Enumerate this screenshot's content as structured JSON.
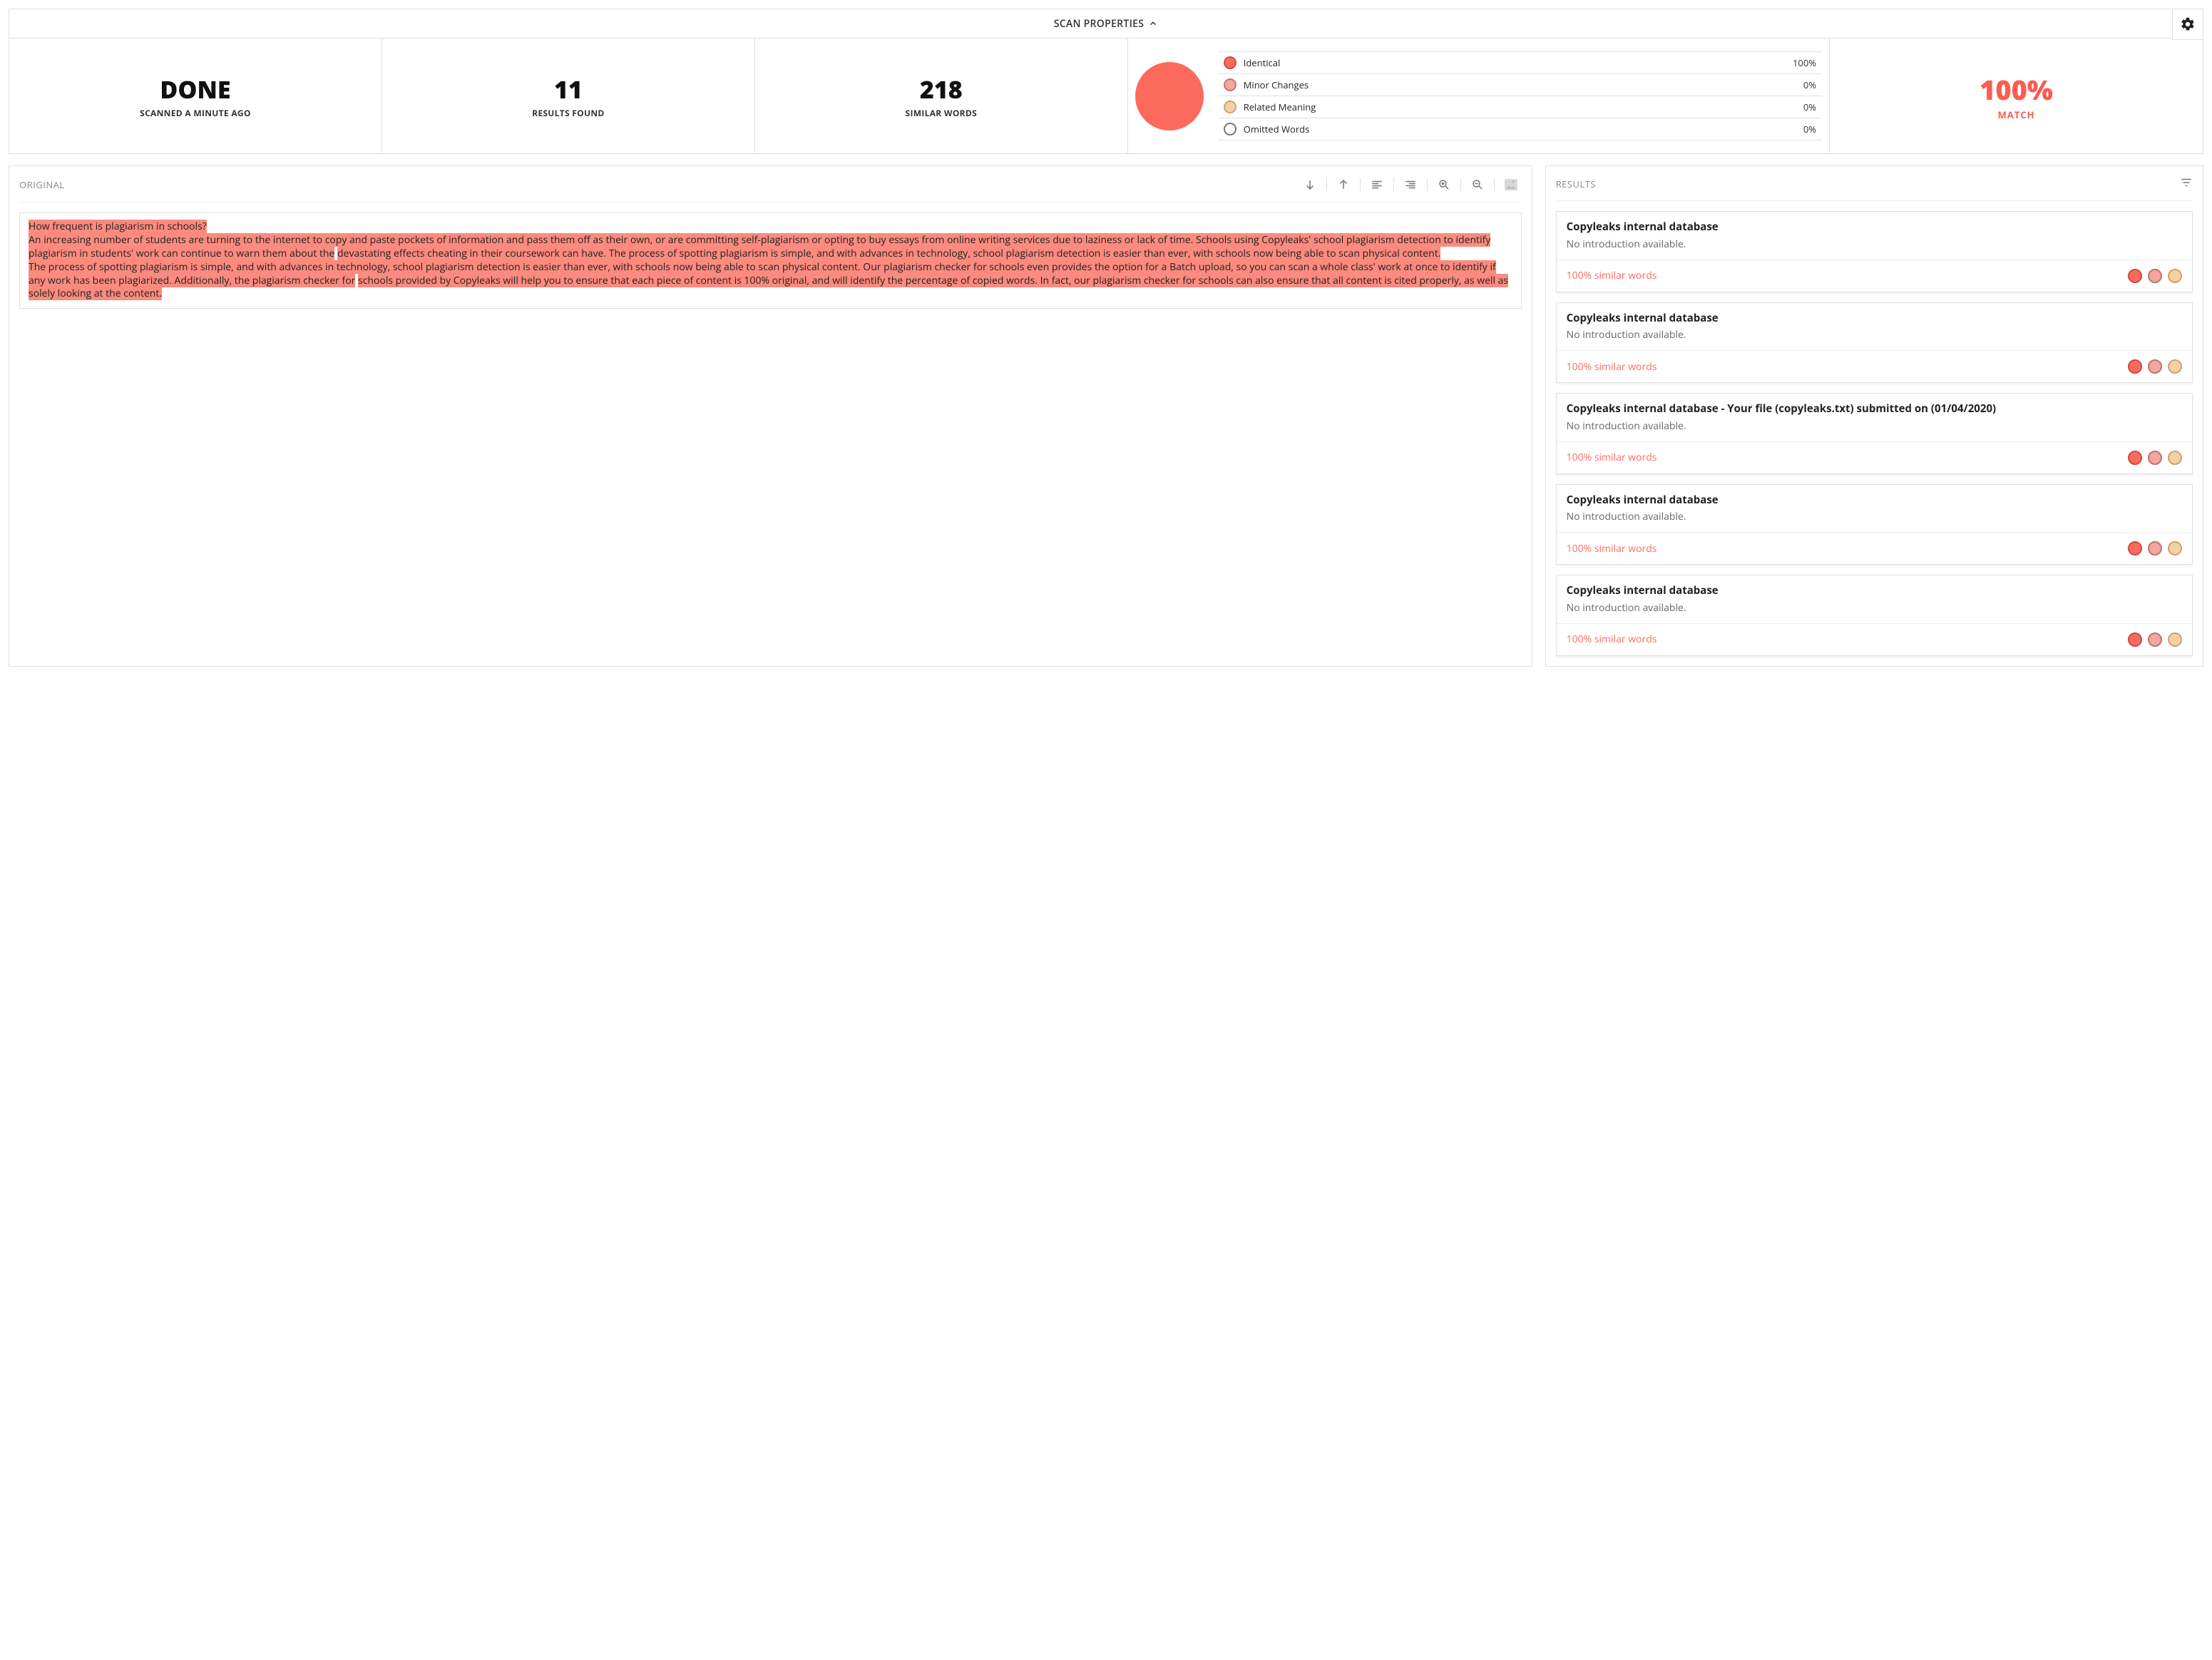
{
  "topbar": {
    "scan_properties_label": "SCAN PROPERTIES"
  },
  "stats": {
    "status": "DONE",
    "status_sub": "SCANNED A MINUTE AGO",
    "results_found": "11",
    "results_found_label": "RESULTS FOUND",
    "similar_words": "218",
    "similar_words_label": "SIMILAR WORDS",
    "match_percent": "100%",
    "match_label": "MATCH"
  },
  "legend": [
    {
      "label": "Identical",
      "value": "100%"
    },
    {
      "label": "Minor Changes",
      "value": "0%"
    },
    {
      "label": "Related Meaning",
      "value": "0%"
    },
    {
      "label": "Omitted Words",
      "value": "0%"
    }
  ],
  "original_label": "ORIGINAL",
  "document": {
    "line1": "How frequent is plagiarism in schools?",
    "line2a": "An increasing number of students are turning to the internet to copy and paste pockets of information and pass them off as their own, or are committing self-plagiarism or opting to buy essays from online writing services due to laziness or lack of time. Schools using Copyleaks' school plagiarism detection to identify plagiarism in students' work can continue to warn them about the",
    "line2b": "devastating effects cheating in their coursework can have. The process of spotting plagiarism is simple, and with advances in technology, school plagiarism detection is easier than ever, with schools now being able to scan physical content.",
    "line3a": "The process of spotting plagiarism is simple, and with advances in technology, school plagiarism detection is easier than ever, with schools now being able to scan physical content. Our plagiarism checker for schools even provides the option for a Batch upload, so you can scan a whole class' work at once to identify if any work has been plagiarized. Additionally, the plagiarism checker for",
    "line3b": "schools provided by Copyleaks will help you to ensure that each piece of content is 100% original, and will identify the percentage of copied words. In fact, our plagiarism checker for schools can also ensure that all content is cited properly, as well as solely looking at the content."
  },
  "results_label": "RESULTS",
  "results": [
    {
      "title": "Copyleaks internal database",
      "sub": "No introduction available.",
      "similar": "100% similar words"
    },
    {
      "title": "Copyleaks internal database",
      "sub": "No introduction available.",
      "similar": "100% similar words"
    },
    {
      "title": "Copyleaks internal database - Your file (copyleaks.txt) submitted on (01/04/2020)",
      "sub": "No introduction available.",
      "similar": "100% similar words"
    },
    {
      "title": "Copyleaks internal database",
      "sub": "No introduction available.",
      "similar": "100% similar words"
    },
    {
      "title": "Copyleaks internal database",
      "sub": "No introduction available.",
      "similar": "100% similar words"
    }
  ],
  "chart_data": {
    "type": "pie",
    "title": "Similarity breakdown",
    "categories": [
      "Identical",
      "Minor Changes",
      "Related Meaning",
      "Omitted Words"
    ],
    "values": [
      100,
      0,
      0,
      0
    ],
    "colors": [
      "#fc6a5e",
      "#f5a59d",
      "#f5d0a3",
      "#ffffff"
    ]
  }
}
